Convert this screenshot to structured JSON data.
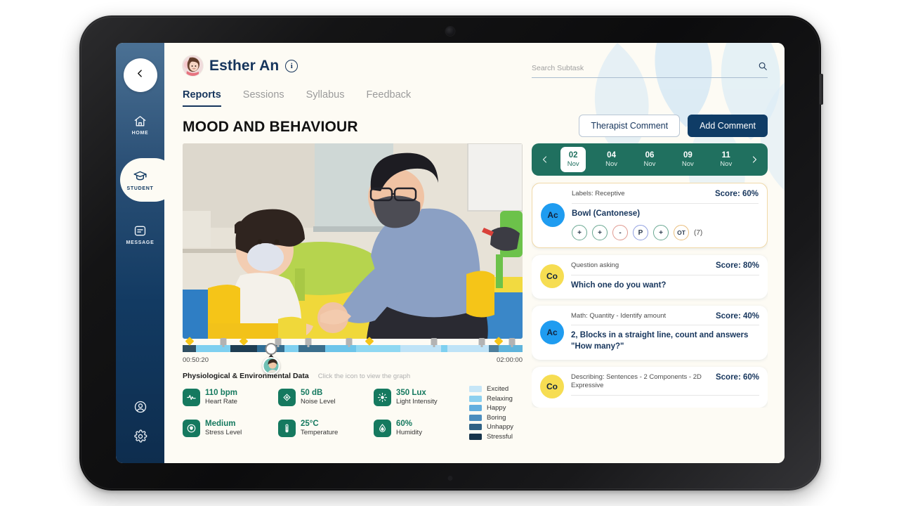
{
  "sidebar": {
    "back_icon": "chevron-left-icon",
    "items": [
      {
        "label": "HOME",
        "icon": "home-icon",
        "active": false
      },
      {
        "label": "STUDENT",
        "icon": "graduation-cap-icon",
        "active": true
      },
      {
        "label": "MESSAGE",
        "icon": "message-icon",
        "active": false
      }
    ],
    "bottom_items": [
      {
        "icon": "account-icon"
      },
      {
        "icon": "gear-icon"
      }
    ]
  },
  "header": {
    "student_name": "Esther An",
    "info_icon": "info-icon",
    "avatar_icon": "avatar",
    "tabs": [
      {
        "label": "Reports",
        "active": true
      },
      {
        "label": "Sessions",
        "active": false
      },
      {
        "label": "Syllabus",
        "active": false
      },
      {
        "label": "Feedback",
        "active": false
      }
    ],
    "page_title": "MOOD AND BEHAVIOUR"
  },
  "search": {
    "placeholder": "Search Subtask",
    "value": "",
    "icon": "search-icon"
  },
  "actions": {
    "therapist_comment": "Therapist Comment",
    "add_comment": "Add Comment"
  },
  "video": {
    "timeline": {
      "start_time": "00:50:20",
      "end_time": "02:00:00",
      "playhead_percent": 26,
      "segments": [
        {
          "width": 4.0,
          "color": "#2f4f63"
        },
        {
          "width": 10.0,
          "color": "#7fd0f0"
        },
        {
          "width": 8.0,
          "color": "#1e3d52"
        },
        {
          "width": 2.0,
          "color": "#2f6e96"
        },
        {
          "width": 6.0,
          "color": "#356d8f"
        },
        {
          "width": 4.0,
          "color": "#7fd0f0"
        },
        {
          "width": 8.0,
          "color": "#3a6e8c"
        },
        {
          "width": 9.0,
          "color": "#6dc5ea"
        },
        {
          "width": 13.0,
          "color": "#8fd8f2"
        },
        {
          "width": 12.0,
          "color": "#bfe3f7"
        },
        {
          "width": 2.0,
          "color": "#7fd0f0"
        },
        {
          "width": 12.0,
          "color": "#bfe3f7"
        },
        {
          "width": 3.0,
          "color": "#4d7f9c"
        },
        {
          "width": 7.0,
          "color": "#5fb4dc"
        }
      ],
      "diamond_markers": [
        2,
        18,
        55,
        93
      ],
      "grey_markers": [
        12,
        28,
        37,
        49,
        74,
        88,
        97
      ]
    }
  },
  "physio": {
    "title": "Physiological & Environmental Data",
    "hint": "Click the icon to view the graph",
    "metrics": [
      {
        "value": "110 bpm",
        "label": "Heart Rate",
        "icon": "heartbeat-icon"
      },
      {
        "value": "50 dB",
        "label": "Noise Level",
        "icon": "sound-icon"
      },
      {
        "value": "350 Lux",
        "label": "Light Intensity",
        "icon": "brightness-icon"
      },
      {
        "value": "Medium",
        "label": "Stress Level",
        "icon": "stress-head-icon"
      },
      {
        "value": "25°C",
        "label": "Temperature",
        "icon": "thermometer-icon"
      },
      {
        "value": "60%",
        "label": "Humidity",
        "icon": "droplet-icon"
      }
    ],
    "legend": [
      {
        "label": "Excited",
        "color": "#c6e6f7"
      },
      {
        "label": "Relaxing",
        "color": "#8cd0ef"
      },
      {
        "label": "Happy",
        "color": "#62aede"
      },
      {
        "label": "Boring",
        "color": "#4b8dbe"
      },
      {
        "label": "Unhappy",
        "color": "#2f6184"
      },
      {
        "label": "Stressful",
        "color": "#17344b"
      }
    ]
  },
  "dates": {
    "prev_icon": "chevron-left-icon",
    "next_icon": "chevron-right-icon",
    "items": [
      {
        "day": "02",
        "month": "Nov",
        "selected": true
      },
      {
        "day": "04",
        "month": "Nov",
        "selected": false
      },
      {
        "day": "06",
        "month": "Nov",
        "selected": false
      },
      {
        "day": "09",
        "month": "Nov",
        "selected": false
      },
      {
        "day": "11",
        "month": "Nov",
        "selected": false
      }
    ]
  },
  "subtask_cards": [
    {
      "badge": "Ac",
      "badge_type": "ac",
      "label": "Labels: Receptive",
      "score": "Score: 60%",
      "title": "Bowl (Cantonese)",
      "highlighted": true,
      "chips": [
        {
          "text": "+",
          "type": "plus"
        },
        {
          "text": "+",
          "type": "plus"
        },
        {
          "text": "-",
          "type": "minus"
        },
        {
          "text": "P",
          "type": "p"
        },
        {
          "text": "+",
          "type": "plus"
        },
        {
          "text": "OT",
          "type": "ot"
        }
      ],
      "chip_count": "(7)"
    },
    {
      "badge": "Co",
      "badge_type": "co",
      "label": "Question asking",
      "score": "Score: 80%",
      "title": "Which one do you want?",
      "highlighted": false,
      "chips": [],
      "chip_count": ""
    },
    {
      "badge": "Ac",
      "badge_type": "ac",
      "label": "Math: Quantity - Identify amount",
      "score": "Score: 40%",
      "title": "2, Blocks in a straight line,  count and answers \"How many?\"",
      "highlighted": false,
      "chips": [],
      "chip_count": ""
    },
    {
      "badge": "Co",
      "badge_type": "co",
      "label": "Describing: Sentences - 2 Components - 2D Expressive",
      "score": "Score: 60%",
      "title": "",
      "highlighted": false,
      "chips": [],
      "chip_count": ""
    }
  ],
  "colors": {
    "sidebar_dark": "#0e2d4e",
    "accent_navy": "#16355c",
    "green": "#20705f",
    "teal_icon": "#15795f",
    "badge_blue": "#1f9cf0",
    "badge_yellow": "#f6dd52"
  }
}
